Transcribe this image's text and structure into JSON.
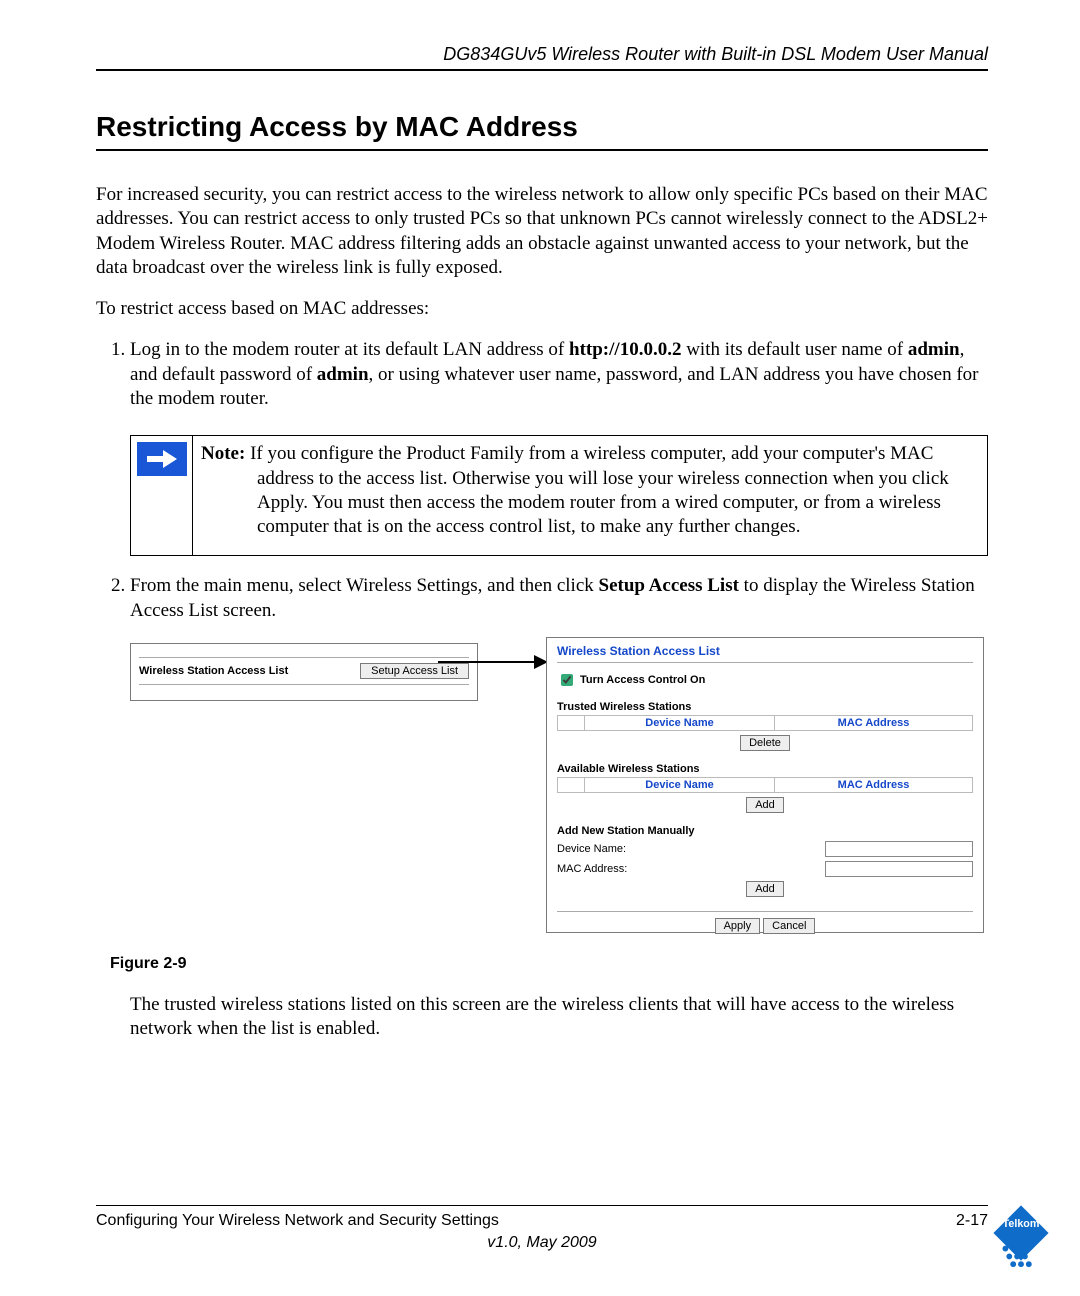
{
  "header": {
    "running": "DG834GUv5 Wireless Router with Built-in DSL Modem User Manual"
  },
  "title": "Restricting Access by MAC Address",
  "para1": "For increased security, you can restrict access to the wireless network to allow only specific PCs based on their MAC addresses. You can restrict access to only trusted PCs so that unknown PCs cannot wirelessly connect to the ADSL2+ Modem Wireless Router. MAC address filtering adds an obstacle against unwanted access to your network, but the data broadcast over the wireless link is fully exposed.",
  "para2": "To restrict access based on MAC addresses:",
  "step1": {
    "pre": "Log in to the modem router at its default LAN address of ",
    "url": "http://10.0.0.2",
    "mid1": " with its default user name of ",
    "user": "admin",
    "mid2": ", and default password of ",
    "pass": "admin",
    "post": ", or using whatever user name, password, and LAN address you have chosen for the modem router."
  },
  "note": {
    "label": "Note:",
    "text": " If you configure the Product Family from a wireless computer, add your computer's MAC address to the access list. Otherwise you will lose your wireless connection when you click Apply. You must then access the modem router from a wired computer, or from a wireless computer that is on the access control list, to make any further changes."
  },
  "step2": {
    "pre": "From the main menu, select Wireless Settings, and then click ",
    "bold": "Setup Access List",
    "post": " to display the Wireless Station Access List screen."
  },
  "mini": {
    "label": "Wireless Station Access List",
    "button": "Setup Access List"
  },
  "panel": {
    "title": "Wireless Station Access List",
    "toggle": "Turn Access Control On",
    "trusted_head": "Trusted Wireless Stations",
    "col_device": "Device Name",
    "col_mac": "MAC Address",
    "btn_delete": "Delete",
    "avail_head": "Available Wireless Stations",
    "btn_add": "Add",
    "manual_head": "Add New Station Manually",
    "lab_device": "Device Name:",
    "lab_mac": "MAC Address:",
    "btn_add2": "Add",
    "btn_apply": "Apply",
    "btn_cancel": "Cancel"
  },
  "figcap": "Figure 2-9",
  "after_fig": "The trusted wireless stations listed on this screen are the wireless clients that will have access to the wireless network when the list is enabled.",
  "footer": {
    "left": "Configuring Your Wireless Network and Security Settings",
    "right": "2-17",
    "version": "v1.0, May 2009"
  },
  "brand": "Telkom"
}
